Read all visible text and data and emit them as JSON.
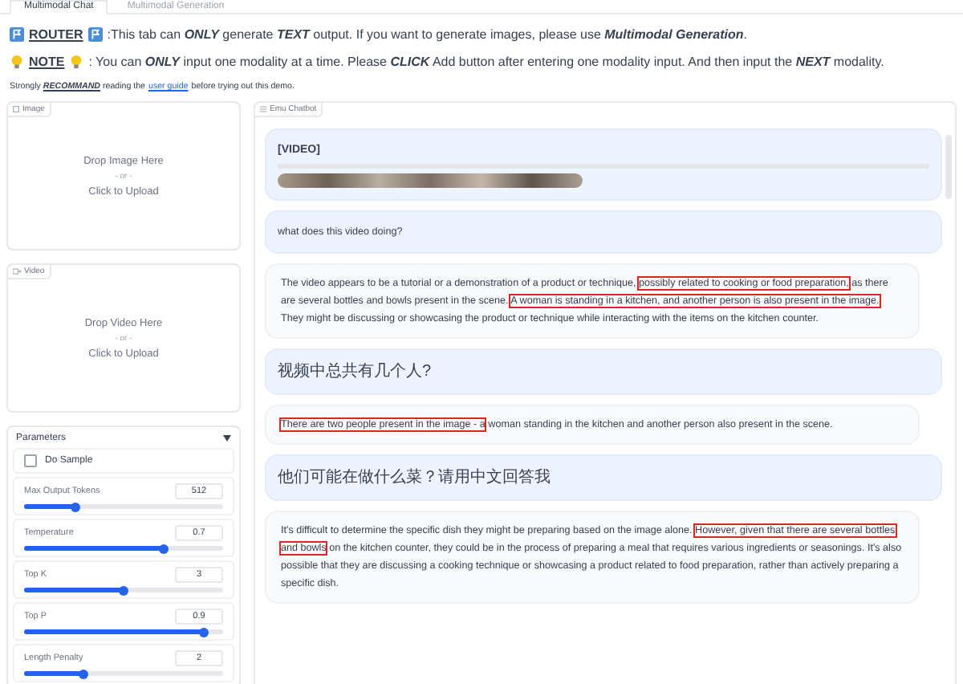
{
  "tabs": [
    {
      "label": "Multimodal Chat",
      "selected": true
    },
    {
      "label": "Multimodal Generation",
      "selected": false
    }
  ],
  "notices": [
    {
      "kind": "router",
      "label": "ROUTER",
      "text": ":This tab can **ONLY** generate **TEXT** output. If you want to generate images, please use **Multimodal Generation**."
    },
    {
      "kind": "note",
      "label": "NOTE",
      "text": ": You can **ONLY** input one modality at a time. Please **CLICK** Add button after entering one modality input. And then input the **NEXT** modality."
    }
  ],
  "recommend": {
    "before": "Strongly **RECOMMAND** reading the",
    "link": "user guide",
    "after": "before trying out this demo."
  },
  "uploads": [
    {
      "kind": "image",
      "label": "Image",
      "drop": "Drop Image Here",
      "or": "- or -",
      "click": "Click to Upload"
    },
    {
      "kind": "video",
      "label": "Video",
      "drop": "Drop Video Here",
      "or": "- or -",
      "click": "Click to Upload"
    }
  ],
  "parameters": {
    "title": "Parameters",
    "expanded": true,
    "checkbox": {
      "label": "Do Sample",
      "checked": false
    },
    "sliders": [
      {
        "label": "Max Output Tokens",
        "value": "512",
        "level": 0.26
      },
      {
        "label": "Temperature",
        "value": "0.7",
        "level": 0.7
      },
      {
        "label": "Top K",
        "value": "3",
        "level": 0.5
      },
      {
        "label": "Top P",
        "value": "0.9",
        "level": 0.9
      },
      {
        "label": "Length Penalty",
        "value": "2",
        "level": 0.3
      }
    ]
  },
  "chatbot": {
    "label": "Emu Chatbot",
    "messages": [
      {
        "kind": "video",
        "label": "[VIDEO]"
      },
      {
        "kind": "question",
        "segments": [
          {
            "text": "what does this video doing?",
            "highlighted": false
          }
        ]
      },
      {
        "kind": "answer",
        "segments": [
          {
            "text": "The video appears to be a tutorial or a demonstration of a product or technique,",
            "highlighted": false
          },
          {
            "text": "possibly related to cooking or food preparation,",
            "highlighted": true
          },
          {
            "text": "as there are several bottles and bowls present in the scene.",
            "highlighted": false
          },
          {
            "text": "A woman is standing in a kitchen, and another person is also present in the image.",
            "highlighted": true
          },
          {
            "text": "They might be discussing or showcasing the product or technique while interacting with the items on the kitchen counter.",
            "highlighted": false
          }
        ]
      },
      {
        "kind": "question",
        "segments": [
          {
            "text": "视频中总共有几个人?",
            "highlighted": false
          }
        ]
      },
      {
        "kind": "answer",
        "segments": [
          {
            "text": "There are two people present in the image - a",
            "highlighted": true
          },
          {
            "text": "woman standing in the kitchen and another person also present in the scene.",
            "highlighted": false
          }
        ]
      },
      {
        "kind": "question",
        "segments": [
          {
            "text": "他们可能在做什么菜？请用中文回答我",
            "highlighted": false
          }
        ]
      },
      {
        "kind": "answer",
        "segments": [
          {
            "text": "It's difficult to determine the specific dish they might be preparing based on the image alone.",
            "highlighted": false
          },
          {
            "text": "However, given that there are several bottles and bowls",
            "highlighted": true
          },
          {
            "text": "on the kitchen counter, they could be in the process of preparing a meal that requires various ingredients or seasonings. It's also possible that they are discussing a cooking technique or showcasing a product related to food preparation, rather than actively preparing a specific dish.",
            "highlighted": false
          }
        ]
      }
    ]
  }
}
